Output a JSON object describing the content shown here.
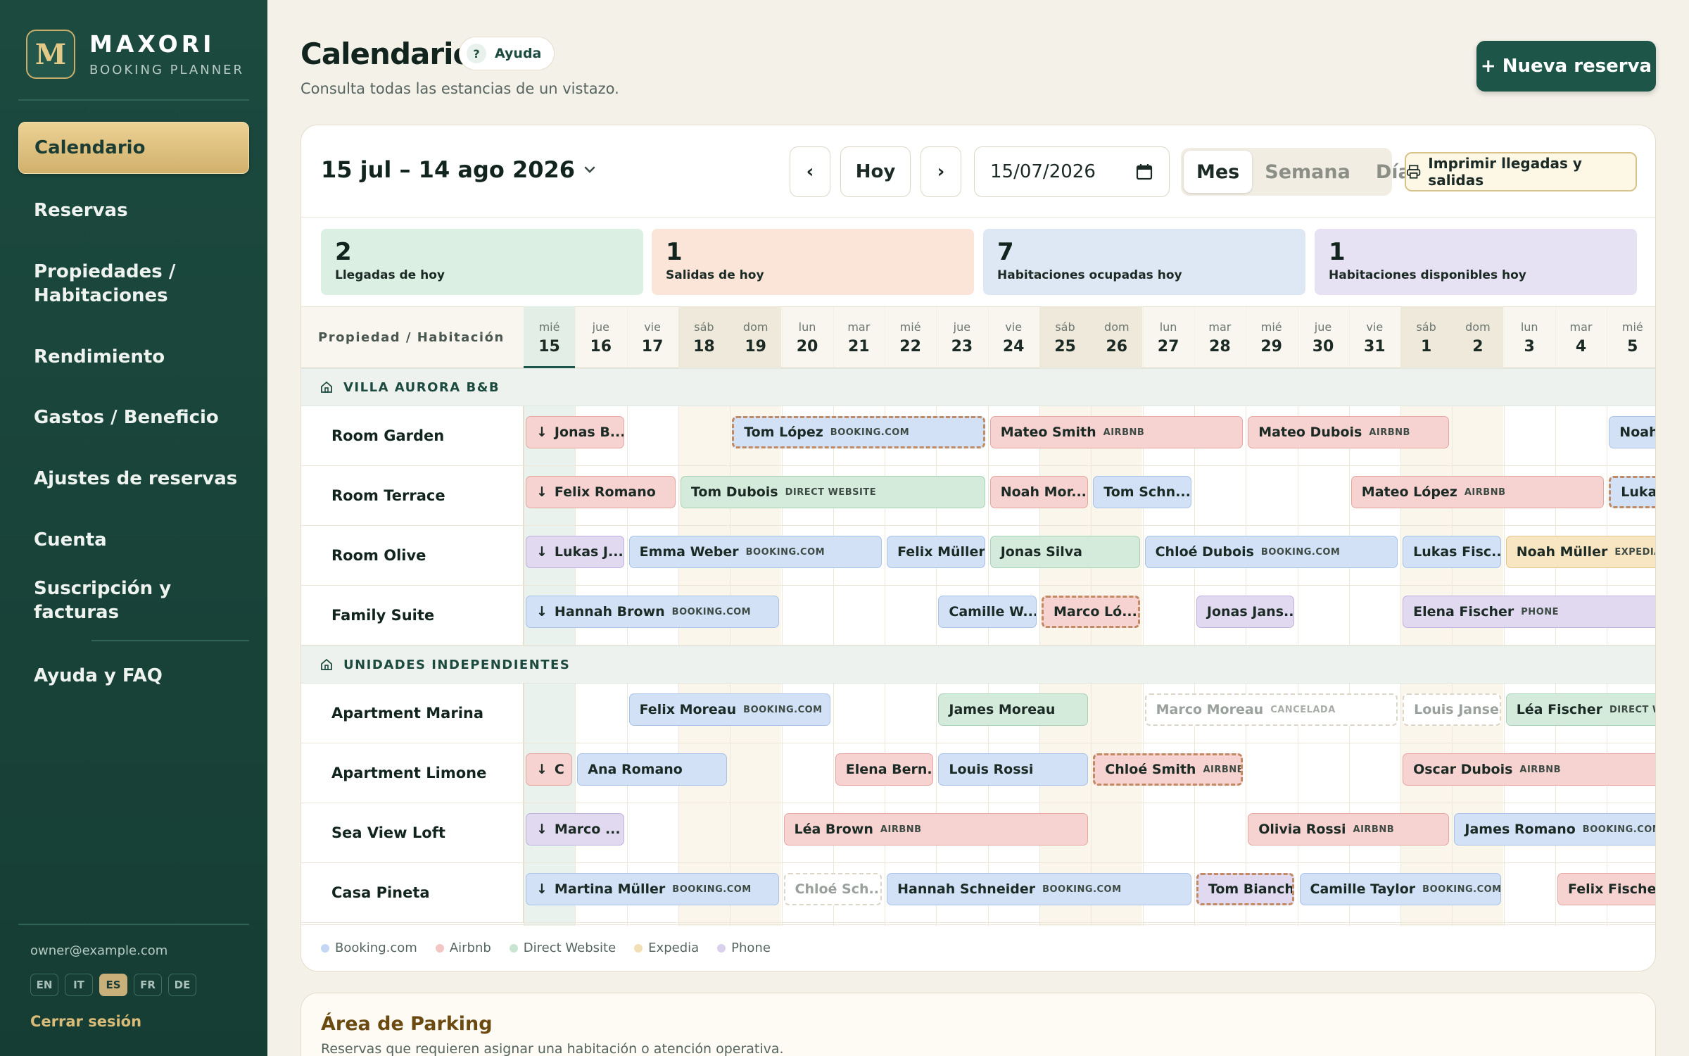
{
  "brand": {
    "initial": "M",
    "name": "MAXORI",
    "subtitle": "BOOKING PLANNER"
  },
  "nav": [
    {
      "label": "Calendario",
      "active": true
    },
    {
      "label": "Reservas"
    },
    {
      "label": "Propiedades / Habitaciones"
    },
    {
      "label": "Rendimiento"
    },
    {
      "label": "Gastos / Beneficio"
    },
    {
      "label": "Ajustes de reservas"
    },
    {
      "label": "Cuenta"
    },
    {
      "label": "Suscripción y facturas"
    },
    {
      "label": "Ayuda y FAQ"
    }
  ],
  "account": {
    "email": "owner@example.com",
    "languages": [
      "EN",
      "IT",
      "ES",
      "FR",
      "DE"
    ],
    "active_language": "ES",
    "logout": "Cerrar sesión"
  },
  "header": {
    "title": "Calendario",
    "help": "Ayuda",
    "help_icon": "?",
    "subtitle": "Consulta todas las estancias de un vistazo.",
    "new_booking": "+ Nueva reserva"
  },
  "toolbar": {
    "range": "15 jul – 14 ago 2026",
    "prev": "‹",
    "today": "Hoy",
    "next": "›",
    "date_value": "15/07/2026",
    "views": [
      "Mes",
      "Semana",
      "Día"
    ],
    "active_view": "Mes",
    "print": "Imprimir llegadas y salidas"
  },
  "stats": [
    {
      "value": "2",
      "label": "Llegadas de hoy",
      "color": "#dcefe3"
    },
    {
      "value": "1",
      "label": "Salidas de hoy",
      "color": "#fbe5d8"
    },
    {
      "value": "7",
      "label": "Habitaciones ocupadas hoy",
      "color": "#dde8f4"
    },
    {
      "value": "1",
      "label": "Habitaciones disponibles hoy",
      "color": "#e6e1f3"
    }
  ],
  "calendar": {
    "column_header": "Propiedad / Habitación",
    "days": [
      {
        "dow": "mié",
        "num": "15",
        "we": false,
        "today": true
      },
      {
        "dow": "jue",
        "num": "16",
        "we": false
      },
      {
        "dow": "vie",
        "num": "17",
        "we": false
      },
      {
        "dow": "sáb",
        "num": "18",
        "we": true
      },
      {
        "dow": "dom",
        "num": "19",
        "we": true
      },
      {
        "dow": "lun",
        "num": "20",
        "we": false
      },
      {
        "dow": "mar",
        "num": "21",
        "we": false
      },
      {
        "dow": "mié",
        "num": "22",
        "we": false
      },
      {
        "dow": "jue",
        "num": "23",
        "we": false
      },
      {
        "dow": "vie",
        "num": "24",
        "we": false
      },
      {
        "dow": "sáb",
        "num": "25",
        "we": true
      },
      {
        "dow": "dom",
        "num": "26",
        "we": true
      },
      {
        "dow": "lun",
        "num": "27",
        "we": false
      },
      {
        "dow": "mar",
        "num": "28",
        "we": false
      },
      {
        "dow": "mié",
        "num": "29",
        "we": false
      },
      {
        "dow": "jue",
        "num": "30",
        "we": false
      },
      {
        "dow": "vie",
        "num": "31",
        "we": false
      },
      {
        "dow": "sáb",
        "num": "1",
        "we": true
      },
      {
        "dow": "dom",
        "num": "2",
        "we": true
      },
      {
        "dow": "lun",
        "num": "3",
        "we": false
      },
      {
        "dow": "mar",
        "num": "4",
        "we": false
      },
      {
        "dow": "mié",
        "num": "5",
        "we": false
      }
    ],
    "groups": [
      {
        "name": "VILLA AURORA B&B",
        "rooms": [
          {
            "name": "Room Garden",
            "bookings": [
              {
                "start": 0,
                "len": 2,
                "guest": "Jonas B...",
                "arrival": true,
                "type": "airbnb"
              },
              {
                "start": 4,
                "len": 5,
                "guest": "Tom López",
                "src": "BOOKING.COM",
                "type": "booking",
                "pending": true
              },
              {
                "start": 9,
                "len": 5,
                "guest": "Mateo Smith",
                "src": "AIRBNB",
                "type": "airbnb"
              },
              {
                "start": 14,
                "len": 4,
                "guest": "Mateo Dubois",
                "src": "AIRBNB",
                "type": "airbnb"
              },
              {
                "start": 21,
                "len": 1.4,
                "guest": "Noah",
                "type": "booking"
              }
            ]
          },
          {
            "name": "Room Terrace",
            "bookings": [
              {
                "start": 0,
                "len": 3,
                "guest": "Felix Romano",
                "arrival": true,
                "type": "airbnb"
              },
              {
                "start": 3,
                "len": 6,
                "guest": "Tom Dubois",
                "src": "DIRECT WEBSITE",
                "type": "direct"
              },
              {
                "start": 9,
                "len": 2,
                "guest": "Noah Mor...",
                "type": "airbnb"
              },
              {
                "start": 11,
                "len": 2,
                "guest": "Tom Schn...",
                "type": "booking"
              },
              {
                "start": 16,
                "len": 5,
                "guest": "Mateo López",
                "src": "AIRBNB",
                "type": "airbnb"
              },
              {
                "start": 21,
                "len": 1.4,
                "guest": "Lukas",
                "type": "booking",
                "pending": true
              }
            ]
          },
          {
            "name": "Room Olive",
            "bookings": [
              {
                "start": 0,
                "len": 2,
                "guest": "Lukas J...",
                "arrival": true,
                "type": "phone"
              },
              {
                "start": 2,
                "len": 5,
                "guest": "Emma Weber",
                "src": "BOOKING.COM",
                "type": "booking"
              },
              {
                "start": 7,
                "len": 2,
                "guest": "Felix Müller",
                "type": "booking"
              },
              {
                "start": 9,
                "len": 3,
                "guest": "Jonas Silva",
                "type": "direct"
              },
              {
                "start": 12,
                "len": 5,
                "guest": "Chloé Dubois",
                "src": "BOOKING.COM",
                "type": "booking"
              },
              {
                "start": 17,
                "len": 2,
                "guest": "Lukas Fisc...",
                "type": "booking"
              },
              {
                "start": 19,
                "len": 3.4,
                "guest": "Noah Müller",
                "src": "EXPEDIA",
                "type": "expedia"
              }
            ]
          },
          {
            "name": "Family Suite",
            "bookings": [
              {
                "start": 0,
                "len": 5,
                "guest": "Hannah Brown",
                "src": "BOOKING.COM",
                "arrival": true,
                "type": "booking"
              },
              {
                "start": 8,
                "len": 2,
                "guest": "Camille W...",
                "type": "booking"
              },
              {
                "start": 10,
                "len": 2,
                "guest": "Marco Ló...",
                "type": "airbnb",
                "pending": true
              },
              {
                "start": 13,
                "len": 2,
                "guest": "Jonas Jans...",
                "type": "phone"
              },
              {
                "start": 17,
                "len": 5.4,
                "guest": "Elena Fischer",
                "src": "PHONE",
                "type": "phone"
              }
            ]
          }
        ]
      },
      {
        "name": "UNIDADES INDEPENDIENTES",
        "rooms": [
          {
            "name": "Apartment Marina",
            "bookings": [
              {
                "start": 2,
                "len": 4,
                "guest": "Felix Moreau",
                "src": "BOOKING.COM",
                "type": "booking"
              },
              {
                "start": 8,
                "len": 3,
                "guest": "James Moreau",
                "type": "direct"
              },
              {
                "start": 12,
                "len": 5,
                "guest": "Marco Moreau",
                "src": "CANCELADA",
                "type": "cancel"
              },
              {
                "start": 17,
                "len": 2,
                "guest": "Louis Jansen",
                "type": "cancel"
              },
              {
                "start": 19,
                "len": 3.4,
                "guest": "Léa Fischer",
                "src": "DIRECT WEBSITE",
                "type": "direct"
              }
            ]
          },
          {
            "name": "Apartment Limone",
            "bookings": [
              {
                "start": 0,
                "len": 1,
                "guest": "C",
                "arrival": true,
                "type": "airbnb"
              },
              {
                "start": 1,
                "len": 3,
                "guest": "Ana Romano",
                "type": "booking"
              },
              {
                "start": 6,
                "len": 2,
                "guest": "Elena Bern...",
                "type": "airbnb"
              },
              {
                "start": 8,
                "len": 3,
                "guest": "Louis Rossi",
                "type": "booking"
              },
              {
                "start": 11,
                "len": 3,
                "guest": "Chloé Smith",
                "src": "AIRBNB",
                "type": "airbnb",
                "pending": true
              },
              {
                "start": 17,
                "len": 5.4,
                "guest": "Oscar Dubois",
                "src": "AIRBNB",
                "type": "airbnb"
              }
            ]
          },
          {
            "name": "Sea View Loft",
            "bookings": [
              {
                "start": 0,
                "len": 2,
                "guest": "Marco ...",
                "arrival": true,
                "type": "phone"
              },
              {
                "start": 5,
                "len": 6,
                "guest": "Léa Brown",
                "src": "AIRBNB",
                "type": "airbnb"
              },
              {
                "start": 14,
                "len": 4,
                "guest": "Olivia Rossi",
                "src": "AIRBNB",
                "type": "airbnb"
              },
              {
                "start": 18,
                "len": 4.4,
                "guest": "James Romano",
                "src": "BOOKING.COM",
                "type": "booking"
              }
            ]
          },
          {
            "name": "Casa Pineta",
            "bookings": [
              {
                "start": 0,
                "len": 5,
                "guest": "Martina Müller",
                "src": "BOOKING.COM",
                "arrival": true,
                "type": "booking"
              },
              {
                "start": 5,
                "len": 2,
                "guest": "Chloé Sch...",
                "type": "cancel"
              },
              {
                "start": 7,
                "len": 6,
                "guest": "Hannah Schneider",
                "src": "BOOKING.COM",
                "type": "booking"
              },
              {
                "start": 13,
                "len": 2,
                "guest": "Tom Bianchi",
                "type": "phone",
                "pending": true
              },
              {
                "start": 15,
                "len": 4,
                "guest": "Camille Taylor",
                "src": "BOOKING.COM",
                "type": "booking"
              },
              {
                "start": 20,
                "len": 2.4,
                "guest": "Felix Fischer",
                "type": "airbnb"
              }
            ]
          }
        ]
      }
    ]
  },
  "legend": [
    {
      "label": "Booking.com",
      "color": "#c5d7f2"
    },
    {
      "label": "Airbnb",
      "color": "#f2c6c2"
    },
    {
      "label": "Direct Website",
      "color": "#c9e5d2"
    },
    {
      "label": "Expedia",
      "color": "#f3dfb5"
    },
    {
      "label": "Phone",
      "color": "#d8d0ec"
    }
  ],
  "parking": {
    "title": "Área de Parking",
    "subtitle": "Reservas que requieren asignar una habitación o atención operativa."
  }
}
